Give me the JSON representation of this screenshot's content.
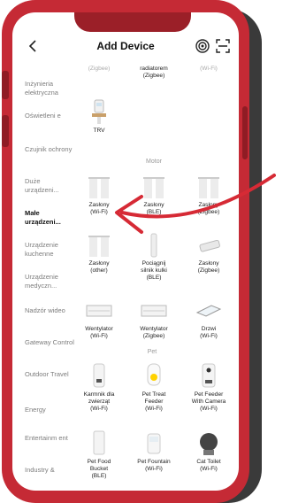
{
  "header": {
    "title": "Add Device"
  },
  "sidebar": {
    "items": [
      {
        "label": "Inżynieria elektryczna"
      },
      {
        "label": "Oświetleni e"
      },
      {
        "label": "Czujnik ochrony"
      },
      {
        "label": "Duże urządzeni..."
      },
      {
        "label": "Małe urządzeni...",
        "active": true
      },
      {
        "label": "Urządzenie kuchenne"
      },
      {
        "label": "Urządzenie medyczn..."
      },
      {
        "label": "Nadzór wideo"
      },
      {
        "label": "Gateway Control"
      },
      {
        "label": "Outdoor Travel"
      },
      {
        "label": "Energy"
      },
      {
        "label": "Entertainm ent"
      },
      {
        "label": "Industry &"
      }
    ]
  },
  "devices": {
    "partial_top": [
      {
        "label": "(Zigbee)"
      },
      {
        "label": "radiatorem\n(Zigbee)"
      },
      {
        "label": "(Wi-Fi)"
      }
    ],
    "trv": {
      "label": "TRV"
    },
    "motor_title": "Motor",
    "motor": [
      {
        "label": "Zasłony\n(Wi-Fi)"
      },
      {
        "label": "Zasłony\n(BLE)"
      },
      {
        "label": "Zasłony\n(Zigbee)"
      },
      {
        "label": "Zasłony\n(other)"
      },
      {
        "label": "Pociągnij\nsilnik kulki\n(BLE)"
      },
      {
        "label": "Zasłony\n(Zigbee)"
      },
      {
        "label": "Wentylator\n(Wi-Fi)"
      },
      {
        "label": "Wentylator\n(Zigbee)"
      },
      {
        "label": "Drzwi\n(Wi-Fi)"
      }
    ],
    "pet_title": "Pet",
    "pet": [
      {
        "label": "Karmnik dla\nzwierząt\n(Wi-Fi)"
      },
      {
        "label": "Pet Treat\nFeeder\n(Wi-Fi)"
      },
      {
        "label": "Pet Feeder\nWith Camera\n(Wi-Fi)"
      },
      {
        "label": "Pet Food\nBucket\n(BLE)"
      },
      {
        "label": "Pet Fountain\n(Wi-Fi)"
      },
      {
        "label": "Cat Toilet\n(Wi-Fi)"
      }
    ]
  },
  "colors": {
    "frame": "#c52a35",
    "arrow": "#d62a35",
    "accent": "#ffd200"
  }
}
